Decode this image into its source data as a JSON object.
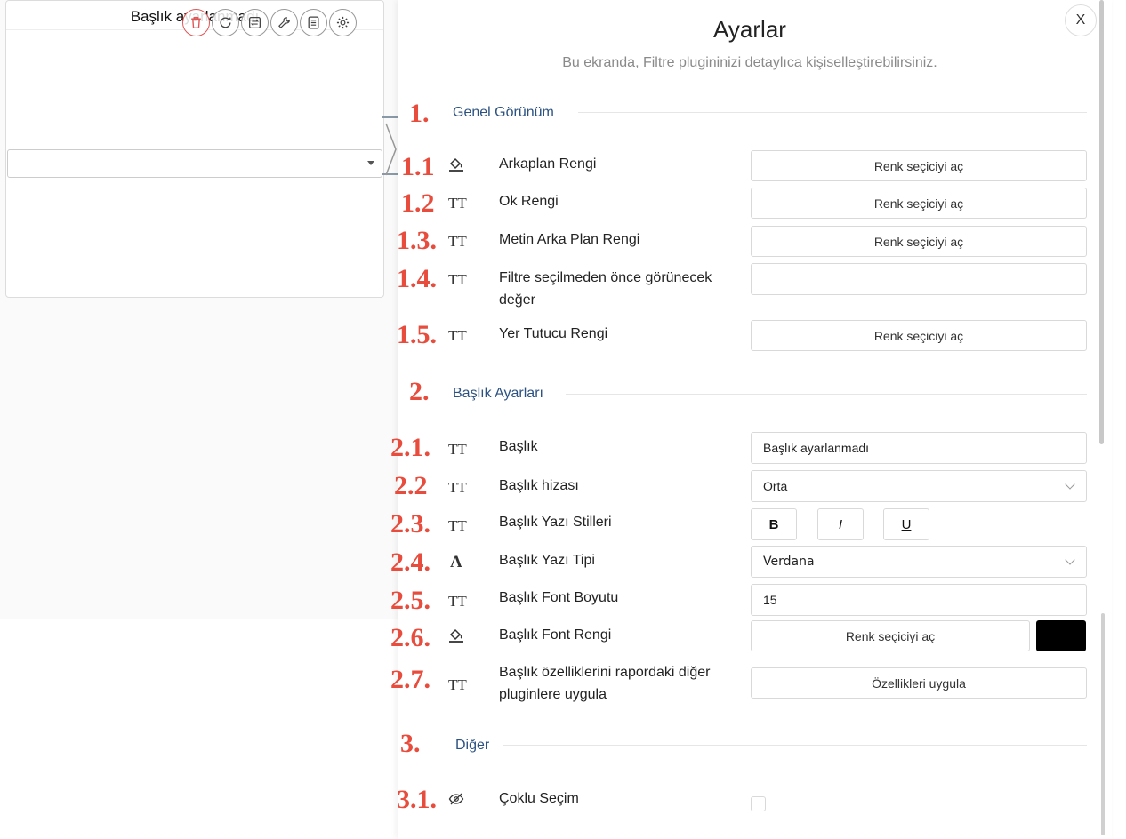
{
  "widget": {
    "title": "Başlık ayarlanmadı",
    "toolbar": [
      "trash-icon",
      "refresh-icon",
      "swap-icon",
      "wrench-icon",
      "list-icon",
      "gear-icon"
    ],
    "select_value": ""
  },
  "panel": {
    "title": "Ayarlar",
    "subtitle": "Bu ekranda, Filtre plugininizi detaylıca kişiselleştirebilirsiniz.",
    "close_label": "X"
  },
  "sections": {
    "s1": {
      "num": "1.",
      "title": "Genel Görünüm"
    },
    "s2": {
      "num": "2.",
      "title": "Başlık Ayarları"
    },
    "s3": {
      "num": "3.",
      "title": "Diğer"
    }
  },
  "rows": {
    "r11": {
      "num": "1.1",
      "icon": "paint-bucket-icon",
      "label": "Arkaplan Rengi",
      "button": "Renk seçiciyi aç"
    },
    "r12": {
      "num": "1.2",
      "icon": "text-size-icon",
      "label": "Ok Rengi",
      "button": "Renk seçiciyi aç"
    },
    "r13": {
      "num": "1.3.",
      "icon": "text-size-icon",
      "label": "Metin Arka Plan Rengi",
      "button": "Renk seçiciyi aç"
    },
    "r14": {
      "num": "1.4.",
      "icon": "text-size-icon",
      "label": "Filtre seçilmeden önce görünecek değer",
      "value": ""
    },
    "r15": {
      "num": "1.5.",
      "icon": "text-size-icon",
      "label": "Yer Tutucu Rengi",
      "button": "Renk seçiciyi aç"
    },
    "r21": {
      "num": "2.1.",
      "icon": "text-size-icon",
      "label": "Başlık",
      "value": "Başlık ayarlanmadı"
    },
    "r22": {
      "num": "2.2",
      "icon": "text-size-icon",
      "label": "Başlık hizası",
      "value": "Orta"
    },
    "r23": {
      "num": "2.3.",
      "icon": "text-size-icon",
      "label": "Başlık Yazı Stilleri",
      "bold": "B",
      "italic": "I",
      "underline": "U"
    },
    "r24": {
      "num": "2.4.",
      "icon": "font-icon",
      "icon_glyph": "A",
      "label": "Başlık Yazı Tipi",
      "value": "Verdana"
    },
    "r25": {
      "num": "2.5.",
      "icon": "text-size-icon",
      "label": "Başlık Font Boyutu",
      "value": "15"
    },
    "r26": {
      "num": "2.6.",
      "icon": "paint-bucket-icon",
      "label": "Başlık Font Rengi",
      "button": "Renk seçiciyi aç",
      "swatch_color": "#000000"
    },
    "r27": {
      "num": "2.7.",
      "icon": "text-size-icon",
      "label": "Başlık özelliklerini rapordaki diğer pluginlere uygula",
      "button": "Özellikleri uygula"
    },
    "r31": {
      "num": "3.1.",
      "icon": "eye-off-icon",
      "label": "Çoklu Seçim",
      "checked": false
    }
  },
  "icon_glyphs": {
    "text_size": "TT"
  },
  "colors": {
    "accent_red": "#e74c3c",
    "section_blue": "#2c5282"
  }
}
